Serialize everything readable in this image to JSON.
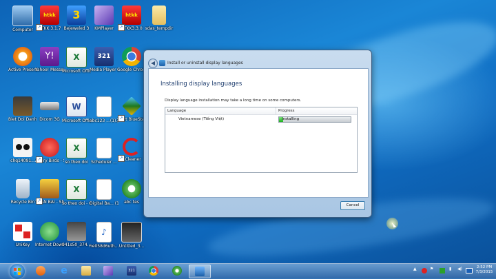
{
  "desktop_icons": [
    {
      "label": "Computer",
      "icon": "computer-icon"
    },
    {
      "label": "HTKK 3.1.7",
      "icon": "htkk-icon"
    },
    {
      "label": "Bejeweled 3",
      "icon": "bejeweled-icon"
    },
    {
      "label": "KMPlayer",
      "icon": "kmplayer-icon"
    },
    {
      "label": "HTKK3.3.0",
      "icon": "htkk-icon"
    },
    {
      "label": "sdas_tempdir",
      "icon": "folder-icon"
    },
    {
      "label": "Active Presenter",
      "icon": "activepresenter-icon"
    },
    {
      "label": "Yahoo! Messenger",
      "icon": "yahoo-icon"
    },
    {
      "label": "Microsoft Office Exc...",
      "icon": "excel-icon"
    },
    {
      "label": "Media Player Classic",
      "icon": "media-player-icon"
    },
    {
      "label": "Google Chrome",
      "icon": "chrome-icon"
    },
    {
      "label": "Biet Doi Danh Thue...",
      "icon": "game-icon"
    },
    {
      "label": "Dicom 3G",
      "icon": "dcom-icon"
    },
    {
      "label": "Microsoft Office Wo...",
      "icon": "word-icon"
    },
    {
      "label": "abc123 ...(1).pdf",
      "icon": "document-icon"
    },
    {
      "label": "Start BlueStacks",
      "icon": "bluestacks-icon"
    },
    {
      "label": "chq14091...",
      "icon": "image-icon"
    },
    {
      "label": "Angry Birds - Shortcut",
      "icon": "angry-birds-icon"
    },
    {
      "label": "so theo doi",
      "icon": "excel-icon"
    },
    {
      "label": "Scheduler ...",
      "icon": "document-icon"
    },
    {
      "label": "CCleaner",
      "icon": "ccleaner-icon"
    },
    {
      "label": "Recycle Bin",
      "icon": "recycle-bin-icon"
    },
    {
      "label": "THAN BAI - Shortcut",
      "icon": "game-icon"
    },
    {
      "label": "so theo doi - Copy",
      "icon": "excel-icon"
    },
    {
      "label": "Digital Ba... (1).pdf",
      "icon": "document-icon"
    },
    {
      "label": "abc tes",
      "icon": "camtasia-icon"
    },
    {
      "label": "UniKey",
      "icon": "unikey-icon"
    },
    {
      "label": "Internet Downlo...",
      "icon": "idm-icon"
    },
    {
      "label": "941s50_374...",
      "icon": "image-icon"
    },
    {
      "label": "he058d6uth...",
      "icon": "audio-icon"
    },
    {
      "label": "Untitled_3...",
      "icon": "video-icon"
    }
  ],
  "dialog": {
    "title": "Install or uninstall display languages",
    "heading": "Installing display languages",
    "description": "Display language installation may take a long time on some computers.",
    "columns": {
      "language": "Language",
      "progress": "Progress"
    },
    "row": {
      "language": "Vietnamese (Tiếng Việt)",
      "status": "Installing",
      "progress": 0.06
    },
    "cancel_label": "Cancel"
  },
  "taskbar": {
    "pinned": [
      "media-player-icon",
      "internet-explorer-icon",
      "folder-icon",
      "kmplayer-icon",
      "media-player-classic-icon",
      "chrome-icon",
      "camtasia-icon",
      "control-panel-icon"
    ],
    "active_index": 7,
    "clock_time": "2:52 PM",
    "clock_date": "7/3/2015",
    "colors": {
      "accent": "#1a86d6",
      "progress": "#1eb21e"
    }
  }
}
